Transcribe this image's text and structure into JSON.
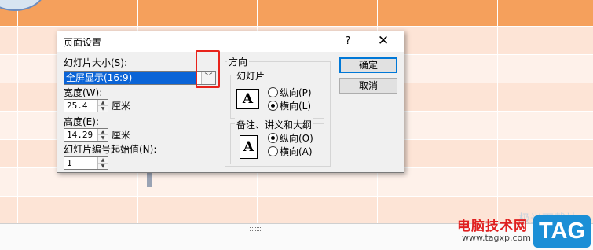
{
  "colors": {
    "header_row": "#f5a05c",
    "row_light": "#fde4d6",
    "row_lighter": "#fef1ea",
    "selection": "#0a64d7",
    "highlight_box": "#e8231b",
    "watermark_red": "#e02020",
    "logo_blue": "#1b8fd6"
  },
  "dialog": {
    "title": "页面设置",
    "help_icon": "?",
    "close_icon": "✕",
    "slide_size_label": "幻灯片大小(S):",
    "slide_size_value": "全屏显示(16:9)",
    "width_label": "宽度(W):",
    "width_value": "25.4",
    "height_label": "高度(E):",
    "height_value": "14.29",
    "unit": "厘米",
    "start_number_label": "幻灯片编号起始值(N):",
    "start_number_value": "1",
    "orientation_title": "方向",
    "slides_group": "幻灯片",
    "notes_group": "备注、讲义和大纲",
    "portrait_p": "纵向(P)",
    "landscape_l": "横向(L)",
    "portrait_o": "纵向(O)",
    "landscape_a": "横向(A)",
    "page_icon_letter": "A",
    "ok": "确定",
    "cancel": "取消"
  },
  "watermark": {
    "site_name": "电脑技术网",
    "url": "www.tagxp.com",
    "logo": "TAG"
  }
}
